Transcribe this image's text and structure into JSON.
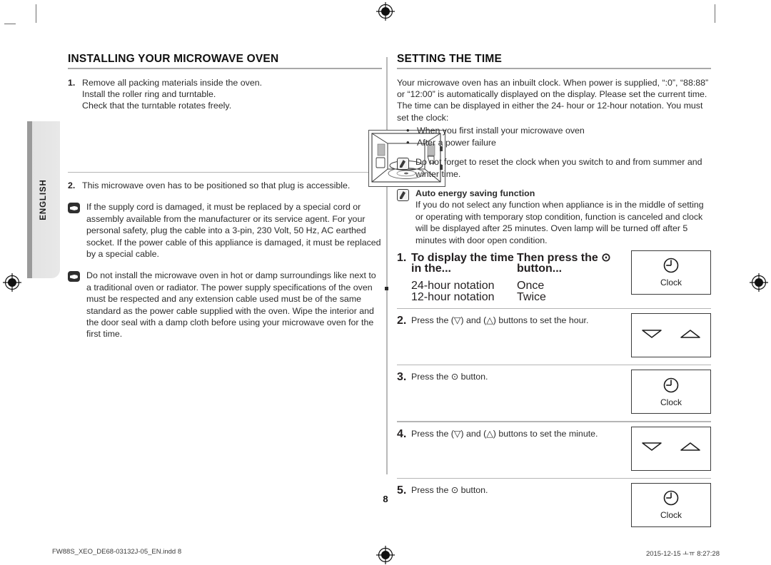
{
  "page": {
    "number": "8",
    "side_tab": "ENGLISH"
  },
  "footer": {
    "file": "FW88S_XEO_DE68-03132J-05_EN.indd   8",
    "timestamp": "2015-12-15   ㅗㅠ 8:27:28"
  },
  "left_column": {
    "heading": "INSTALLING YOUR MICROWAVE OVEN",
    "steps": [
      {
        "num": "1.",
        "lines": [
          "Remove all packing materials inside the oven.",
          "Install the roller ring and turntable.",
          "Check that the turntable rotates freely."
        ]
      },
      {
        "num": "2.",
        "lines": [
          "This microwave oven has to be positioned so that plug is accessible."
        ]
      }
    ],
    "notes": [
      {
        "icon": "pointing-hand-icon",
        "text": "If the supply cord is damaged, it must be replaced by a special cord or assembly available from the manufacturer or its service agent. For your personal safety, plug the cable into a 3-pin, 230 Volt, 50 Hz, AC earthed socket. If the power cable of this appliance is damaged, it must be replaced by a special cable."
      },
      {
        "icon": "pointing-hand-icon",
        "text": "Do not install the microwave oven in hot or damp surroundings like next to a traditional oven or radiator. The power supply specifications of the oven must be respected and any extension cable used must be of the same standard as the power cable supplied with the oven. Wipe the interior and the door seal with a damp cloth before using your microwave oven for the first time."
      }
    ],
    "illustration_alt": "microwave-oven-interior-illustration"
  },
  "right_column": {
    "heading": "SETTING THE TIME",
    "intro": "Your microwave oven has an inbuilt clock. When power is supplied, “:0”, “88:88” or “12:00” is automatically displayed on the display. Please set the current time. The time can be displayed in either the 24- hour or 12-hour notation. You must set the clock:",
    "bullets": [
      "When you first install your microwave oven",
      "After a power failure"
    ],
    "notes": [
      {
        "icon": "note-pencil-icon",
        "title": "",
        "text": "Do not forget to reset the clock when you switch to and from summer and winter time."
      },
      {
        "icon": "note-pencil-icon",
        "title": "Auto energy saving function",
        "text": "If you do not select any function when appliance is in the middle of setting or operating with temporary stop condition, function is canceled and clock will be displayed after 25 minutes. Oven lamp will be turned off after 5 minutes with door open condition."
      }
    ],
    "steps": [
      {
        "num": "1.",
        "table": {
          "header_left": "To display the time in the...",
          "header_right": "Then press the ⊙ button...",
          "rows": [
            {
              "left": "24-hour notation",
              "right": "Once"
            },
            {
              "left": "12-hour notation",
              "right": "Twice"
            }
          ]
        },
        "panel": {
          "type": "clock",
          "label": "Clock"
        }
      },
      {
        "num": "2.",
        "text": "Press the (▽) and (△) buttons to set the hour.",
        "panel": {
          "type": "arrows",
          "label": ""
        }
      },
      {
        "num": "3.",
        "text": "Press the ⊙ button.",
        "panel": {
          "type": "clock",
          "label": "Clock"
        }
      },
      {
        "num": "4.",
        "text": "Press the (▽) and (△) buttons to set the minute.",
        "panel": {
          "type": "arrows",
          "label": ""
        }
      },
      {
        "num": "5.",
        "text": "Press the ⊙ button.",
        "panel": {
          "type": "clock",
          "label": "Clock"
        }
      }
    ]
  }
}
